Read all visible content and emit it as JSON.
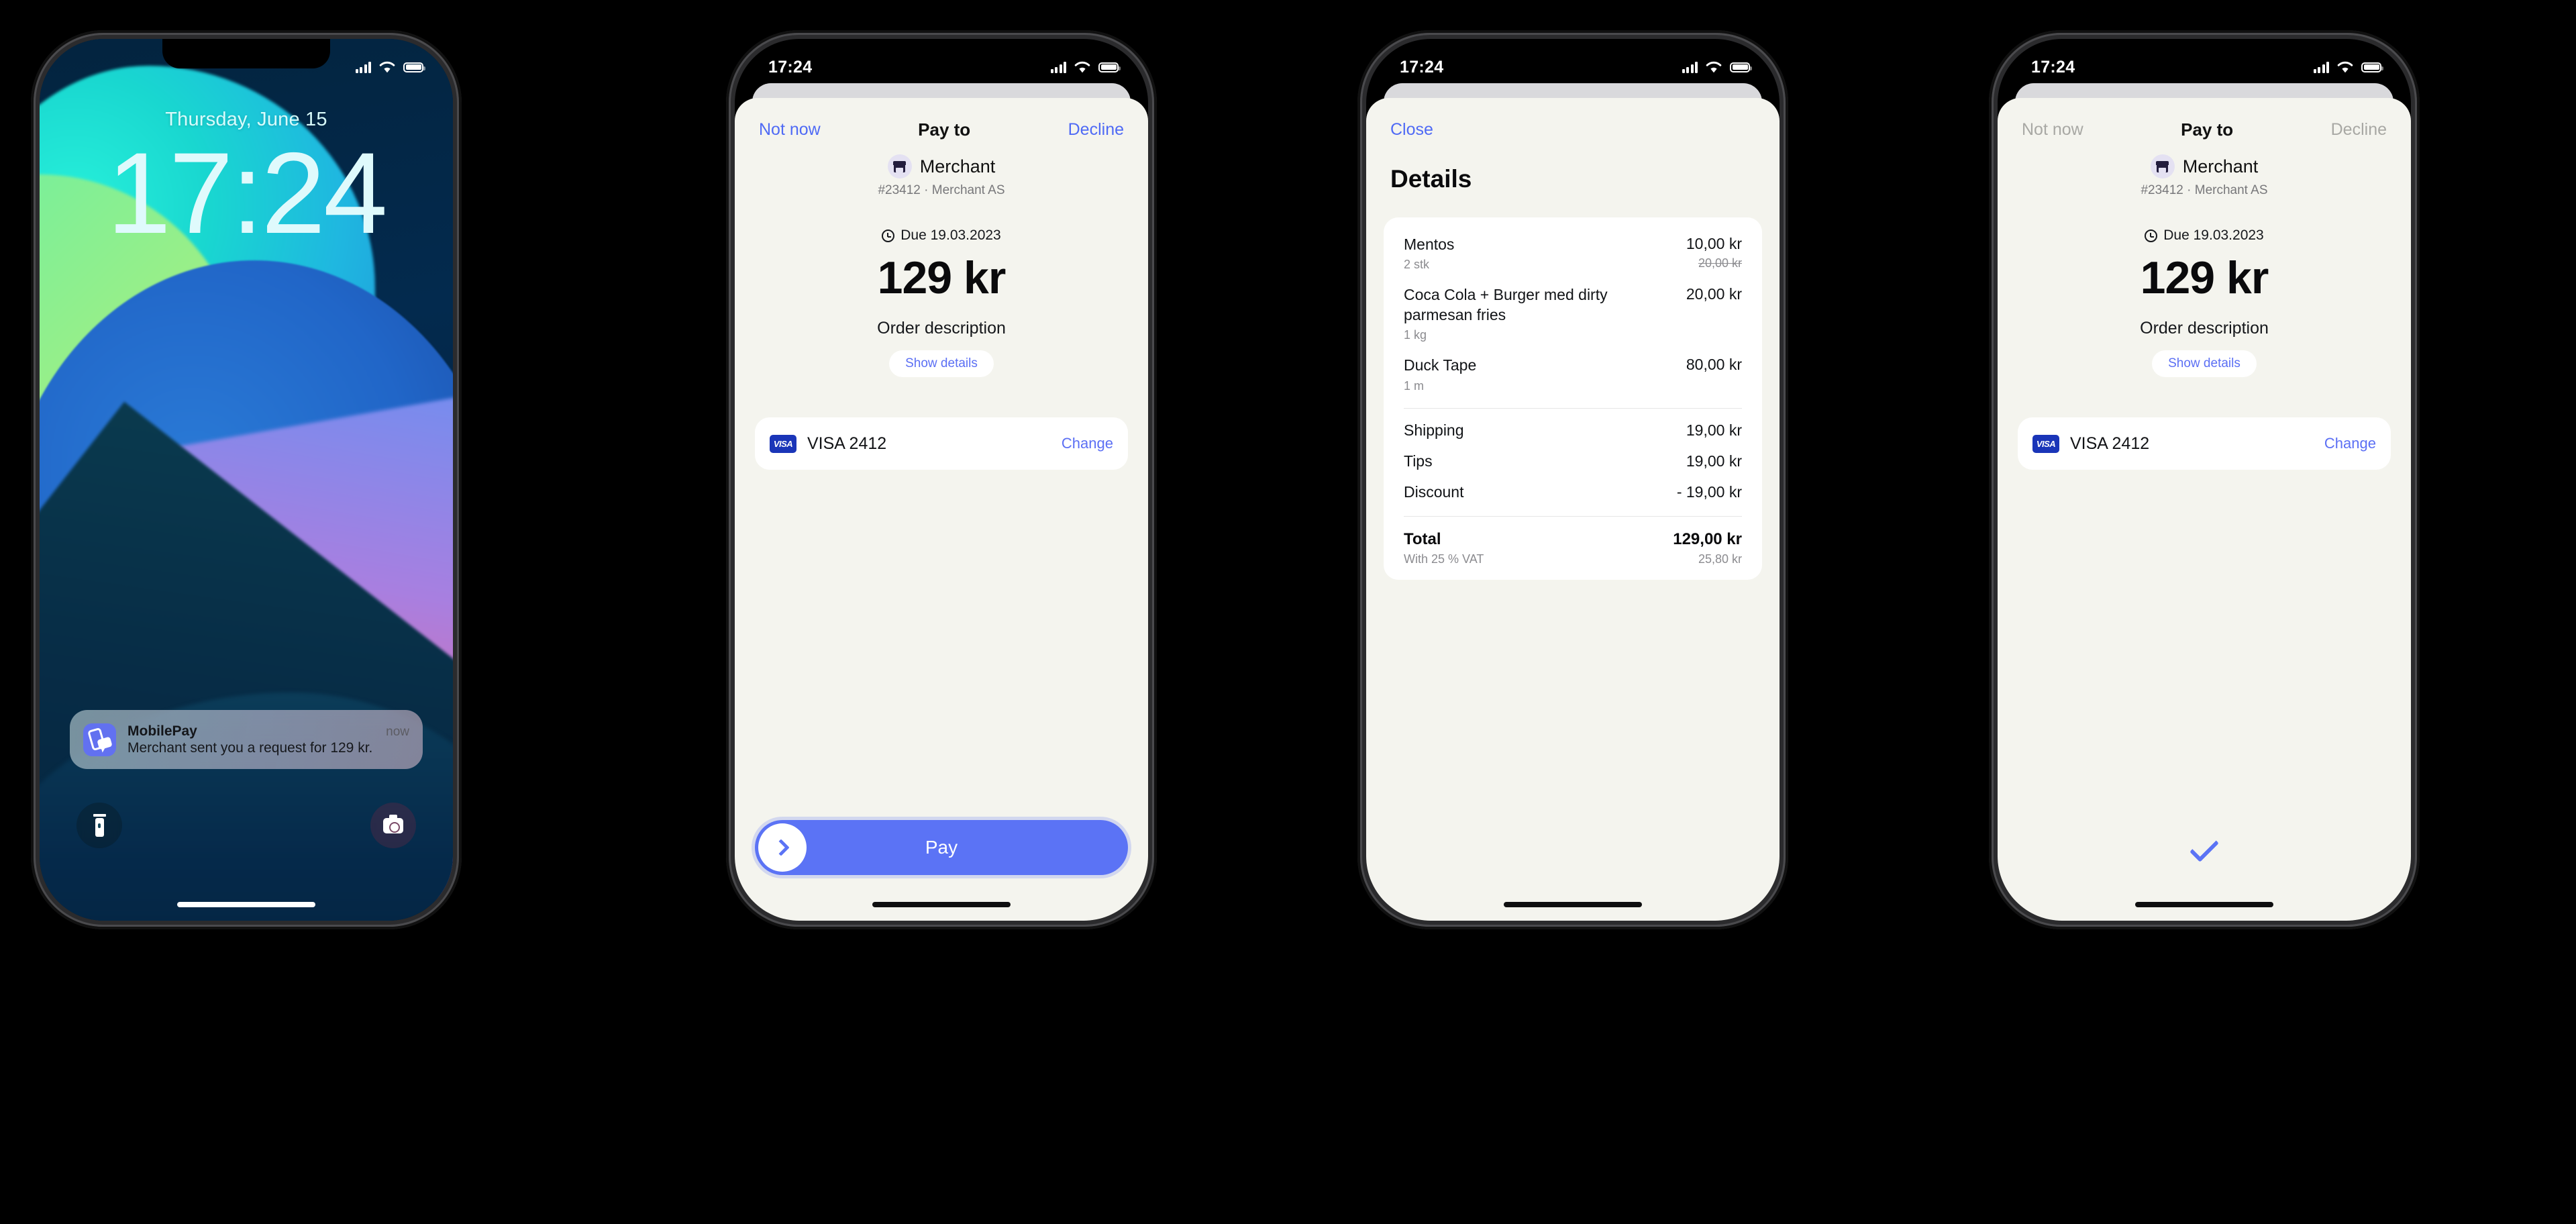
{
  "colors": {
    "accent": "#5b73f5",
    "link": "#4f6af5",
    "sheet_bg": "#f4f4ee",
    "card_bg": "#ffffff",
    "muted": "#8b8b8f",
    "disabled": "#a8a8a4",
    "visa_blue": "#1a35b8",
    "app_icon": "#6271f0"
  },
  "status_bar": {
    "time": "17:24",
    "signal_icon": "cellular-bars-icon",
    "wifi_icon": "wifi-icon",
    "battery_icon": "battery-icon"
  },
  "lockscreen": {
    "date": "Thursday, June 15",
    "time": "17:24",
    "notification": {
      "app": "MobilePay",
      "time": "now",
      "message": "Merchant sent you a request for 129 kr.",
      "icon": "mobilepay-app-icon"
    },
    "flashlight_icon": "flashlight-icon",
    "camera_icon": "camera-icon"
  },
  "pay_sheet": {
    "nav": {
      "left": "Not now",
      "title": "Pay to",
      "right": "Decline"
    },
    "merchant": {
      "avatar_icon": "storefront-icon",
      "name": "Merchant",
      "subtitle": "#23412 · Merchant AS"
    },
    "due": {
      "icon": "clock-icon",
      "label": "Due 19.03.2023"
    },
    "amount": "129 kr",
    "order_description": "Order description",
    "show_details": "Show details",
    "card": {
      "brand_icon": "visa-logo",
      "brand_text": "VISA",
      "label": "VISA 2412",
      "change": "Change"
    },
    "pay_button": {
      "label": "Pay",
      "slider_icon": "chevron-right-icon"
    }
  },
  "details_sheet": {
    "close": "Close",
    "title": "Details",
    "items": [
      {
        "name": "Mentos",
        "qty": "2 stk",
        "price": "10,00 kr",
        "old_price": "20,00 kr"
      },
      {
        "name": "Coca Cola + Burger med dirty parmesan fries",
        "qty": "1 kg",
        "price": "20,00 kr",
        "old_price": ""
      },
      {
        "name": "Duck Tape",
        "qty": "1 m",
        "price": "80,00 kr",
        "old_price": ""
      }
    ],
    "adjustments": [
      {
        "label": "Shipping",
        "value": "19,00 kr"
      },
      {
        "label": "Tips",
        "value": "19,00 kr"
      },
      {
        "label": "Discount",
        "value": "- 19,00 kr"
      }
    ],
    "total": {
      "label": "Total",
      "value": "129,00 kr"
    },
    "vat": {
      "label": "With 25 % VAT",
      "value": "25,80 kr"
    }
  },
  "confirm_sheet": {
    "nav": {
      "left": "Not now",
      "title": "Pay to",
      "right": "Decline"
    },
    "check_icon": "checkmark-icon"
  }
}
